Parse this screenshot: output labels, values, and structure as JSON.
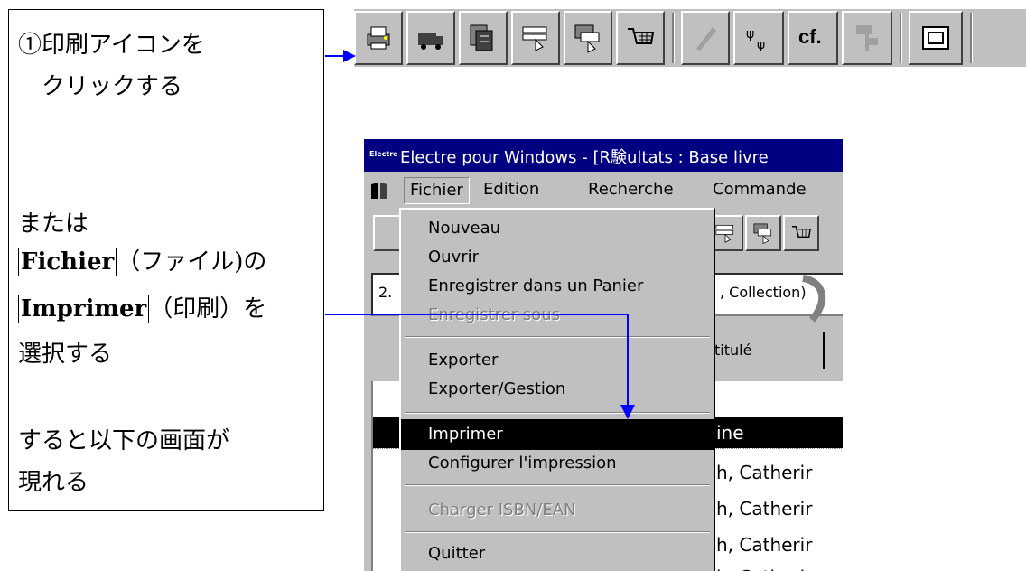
{
  "instructions": {
    "step1_line1": "①印刷アイコンを",
    "step1_line2": "クリックする",
    "or_text": "または",
    "fichier_kw": "Fichier",
    "fichier_note": "（ファイル)の",
    "imprimer_kw": "Imprimer",
    "imprimer_note": "（印刷）を",
    "select_text": "選択する",
    "result_line1": "すると以下の画面が",
    "result_line2": "現れる"
  },
  "toolbar": {
    "icons": [
      "print-icon",
      "truck-icon",
      "document-stack-icon",
      "order-icon",
      "transfer-icon",
      "cart-icon",
      "pen-icon",
      "flower-icon",
      "cf-icon",
      "tree-icon",
      "window-icon"
    ],
    "cf_label": "cf."
  },
  "window": {
    "logo": "Electre",
    "title": "Electre pour Windows - [R験ultats : Base livre",
    "menus": [
      "Fichier",
      "Edition",
      "Recherche",
      "Commande"
    ],
    "combo_prefix": "2.",
    "combo_suffix": ", Collection)",
    "tab_label": "titulé",
    "list_rows": [
      "ine",
      "h, Catherir",
      "h, Catherir",
      "h, Catherir",
      "h, Catherir"
    ]
  },
  "dropdown": {
    "items": [
      {
        "label": "Nouveau",
        "state": "normal"
      },
      {
        "label": "Ouvrir",
        "state": "normal"
      },
      {
        "label": "Enregistrer dans un Panier",
        "state": "normal"
      },
      {
        "label": "Enregistrer sous",
        "state": "disabled"
      },
      {
        "label": "Exporter",
        "state": "normal"
      },
      {
        "label": "Exporter/Gestion",
        "state": "normal"
      },
      {
        "label": "Imprimer",
        "state": "selected"
      },
      {
        "label": "Configurer l'impression",
        "state": "normal"
      },
      {
        "label": "Charger ISBN/EAN",
        "state": "disabled"
      },
      {
        "label": "Quitter",
        "state": "normal"
      }
    ]
  },
  "colors": {
    "arrow": "#0000ff",
    "titlebar": "#000080",
    "face": "#c0c0c0",
    "selection": "#000000"
  }
}
